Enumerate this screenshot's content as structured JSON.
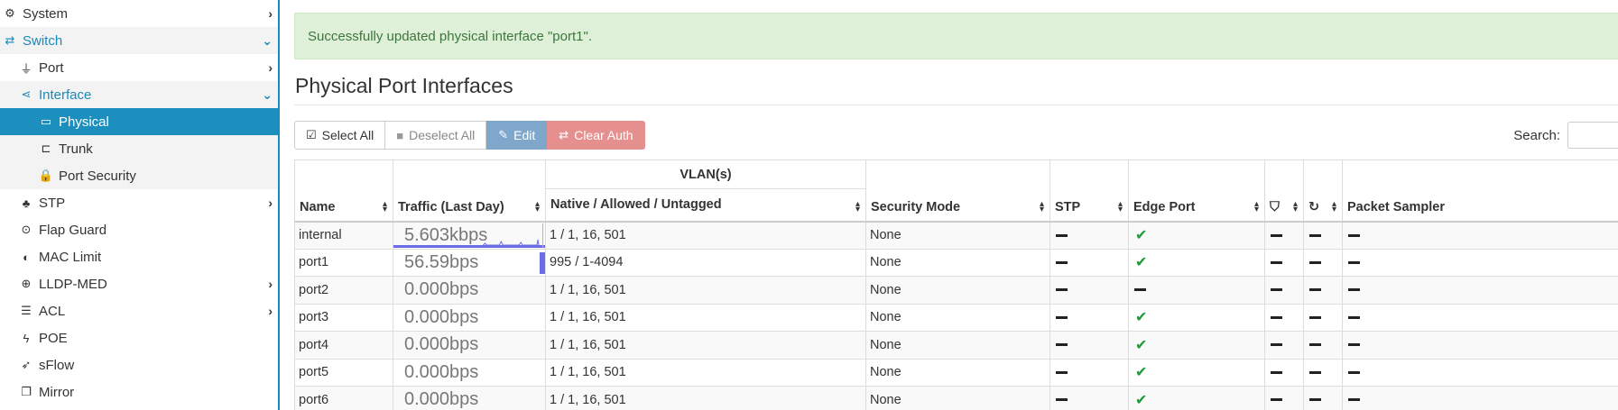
{
  "sidebar": {
    "items": [
      {
        "label": "System",
        "icon": "cogs-icon",
        "glyph": "⚙",
        "level": 0,
        "chevron": "›"
      },
      {
        "label": "Switch",
        "icon": "exchange-icon",
        "glyph": "⇄",
        "level": 0,
        "chevron": "⌄",
        "state": "expanded"
      },
      {
        "label": "Port",
        "icon": "plug-icon",
        "glyph": "⏚",
        "level": 1,
        "chevron": "›"
      },
      {
        "label": "Interface",
        "icon": "share-icon",
        "glyph": "⋖",
        "level": 1,
        "chevron": "⌄",
        "state": "expanded"
      },
      {
        "label": "Physical",
        "icon": "hdd-icon",
        "glyph": "▭",
        "level": 2,
        "state": "selected"
      },
      {
        "label": "Trunk",
        "icon": "trunk-icon",
        "glyph": "⊏",
        "level": 2,
        "state": "sub"
      },
      {
        "label": "Port Security",
        "icon": "lock-icon",
        "glyph": "🔒",
        "level": 2,
        "state": "sub"
      },
      {
        "label": "STP",
        "icon": "tree-icon",
        "glyph": "♣",
        "level": 1,
        "chevron": "›"
      },
      {
        "label": "Flap Guard",
        "icon": "toggle-icon",
        "glyph": "⊙",
        "level": 1
      },
      {
        "label": "MAC Limit",
        "icon": "adjust-icon",
        "glyph": "◐",
        "level": 1
      },
      {
        "label": "LLDP-MED",
        "icon": "search-plus-icon",
        "glyph": "⊕",
        "level": 1,
        "chevron": "›"
      },
      {
        "label": "ACL",
        "icon": "list-icon",
        "glyph": "☰",
        "level": 1,
        "chevron": "›"
      },
      {
        "label": "POE",
        "icon": "bolt-icon",
        "glyph": "ϟ",
        "level": 1
      },
      {
        "label": "sFlow",
        "icon": "paper-plane-icon",
        "glyph": "➶",
        "level": 1
      },
      {
        "label": "Mirror",
        "icon": "clone-icon",
        "glyph": "❐",
        "level": 1
      }
    ]
  },
  "alert": {
    "text": "Successfully updated physical interface \"port1\"."
  },
  "page_title": "Physical Port Interfaces",
  "toolbar": {
    "select_all": "Select All",
    "deselect_all": "Deselect All",
    "edit": "Edit",
    "clear_auth": "Clear Auth"
  },
  "search": {
    "label": "Search:",
    "value": ""
  },
  "table": {
    "vlan_group": "VLAN(s)",
    "columns": {
      "name": "Name",
      "traffic": "Traffic (Last Day)",
      "vlan": "Native / Allowed / Untagged",
      "security": "Security Mode",
      "stp": "STP",
      "edge": "Edge Port",
      "packet_sampler": "Packet Sampler"
    },
    "rows": [
      {
        "name": "internal",
        "traffic": "5.603kbps",
        "vlan": "1 / 1, 16, 501",
        "security": "None",
        "edge": true,
        "spark": "internal"
      },
      {
        "name": "port1",
        "traffic": "56.59bps",
        "vlan": "995 / 1-4094",
        "security": "None",
        "edge": true,
        "spark": "bar"
      },
      {
        "name": "port2",
        "traffic": "0.000bps",
        "vlan": "1 / 1, 16, 501",
        "security": "None",
        "edge": false
      },
      {
        "name": "port3",
        "traffic": "0.000bps",
        "vlan": "1 / 1, 16, 501",
        "security": "None",
        "edge": true
      },
      {
        "name": "port4",
        "traffic": "0.000bps",
        "vlan": "1 / 1, 16, 501",
        "security": "None",
        "edge": true
      },
      {
        "name": "port5",
        "traffic": "0.000bps",
        "vlan": "1 / 1, 16, 501",
        "security": "None",
        "edge": true
      },
      {
        "name": "port6",
        "traffic": "0.000bps",
        "vlan": "1 / 1, 16, 501",
        "security": "None",
        "edge": true
      }
    ]
  },
  "colors": {
    "accent": "#1a8ab8",
    "success_bg": "#dff0d8",
    "check": "#1e9a37",
    "spark": "#6b6be8"
  }
}
